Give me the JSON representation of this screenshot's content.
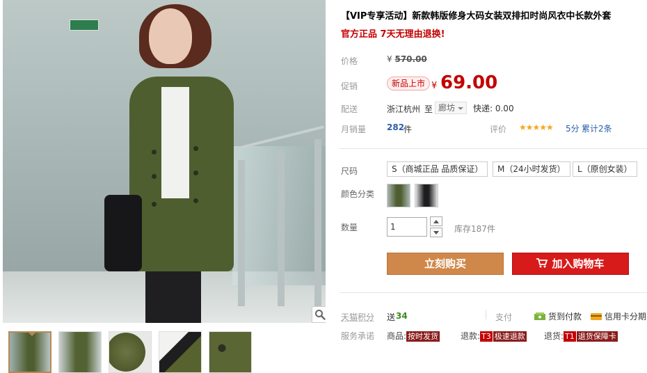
{
  "product": {
    "title": "【VIP专享活动】新款韩版修身大码女装双排扣时尚风衣中长款外套",
    "subtitle": "官方正品 7天无理由退换!"
  },
  "price": {
    "label": "价格",
    "currency": "¥",
    "original": "570.00"
  },
  "promo": {
    "label": "促销",
    "tag": "新品上市",
    "currency": "¥",
    "price": "69.00"
  },
  "shipping": {
    "label": "配送",
    "from": "浙江杭州",
    "to_word": "至",
    "destination": "廊坊",
    "fee": "快递: 0.00"
  },
  "sales": {
    "label": "月销量",
    "count": "282",
    "unit": "件"
  },
  "rating": {
    "label": "评价",
    "stars": "★★★★★",
    "score": "5分",
    "reviews": "累计2条"
  },
  "size": {
    "label": "尺码",
    "options": [
      "S（商城正品 品质保证）",
      "M（24小时发货）",
      "L（原创女装）"
    ]
  },
  "color": {
    "label": "颜色分类"
  },
  "quantity": {
    "label": "数量",
    "value": "1",
    "stock": "库存187件"
  },
  "actions": {
    "buy_now": "立刻购买",
    "add_to_cart": "加入购物车"
  },
  "points": {
    "label": "天猫积分",
    "prefix": "送",
    "value": "34"
  },
  "payment": {
    "label": "支付",
    "cod": "货到付款",
    "credit": "信用卡分期"
  },
  "service": {
    "label": "服务承诺",
    "goods_prefix": "商品:",
    "goods_tag": "按时发货",
    "refund_prefix": "退款:",
    "refund_code": "T3",
    "refund_tag": "极速退款",
    "return_prefix": "退货:",
    "return_code": "T1",
    "return_tag": "退货保障卡"
  },
  "colors": {
    "price_red": "#c40000",
    "buy_button": "#d0884a",
    "cart_button": "#d71b1b",
    "star": "#f5a623",
    "thumb_active": "#b58a53"
  },
  "icons": [
    "zoom-icon",
    "cart-icon",
    "cod-icon",
    "credit-card-icon",
    "chevron-down-icon",
    "arrow-up-icon",
    "arrow-down-icon"
  ]
}
